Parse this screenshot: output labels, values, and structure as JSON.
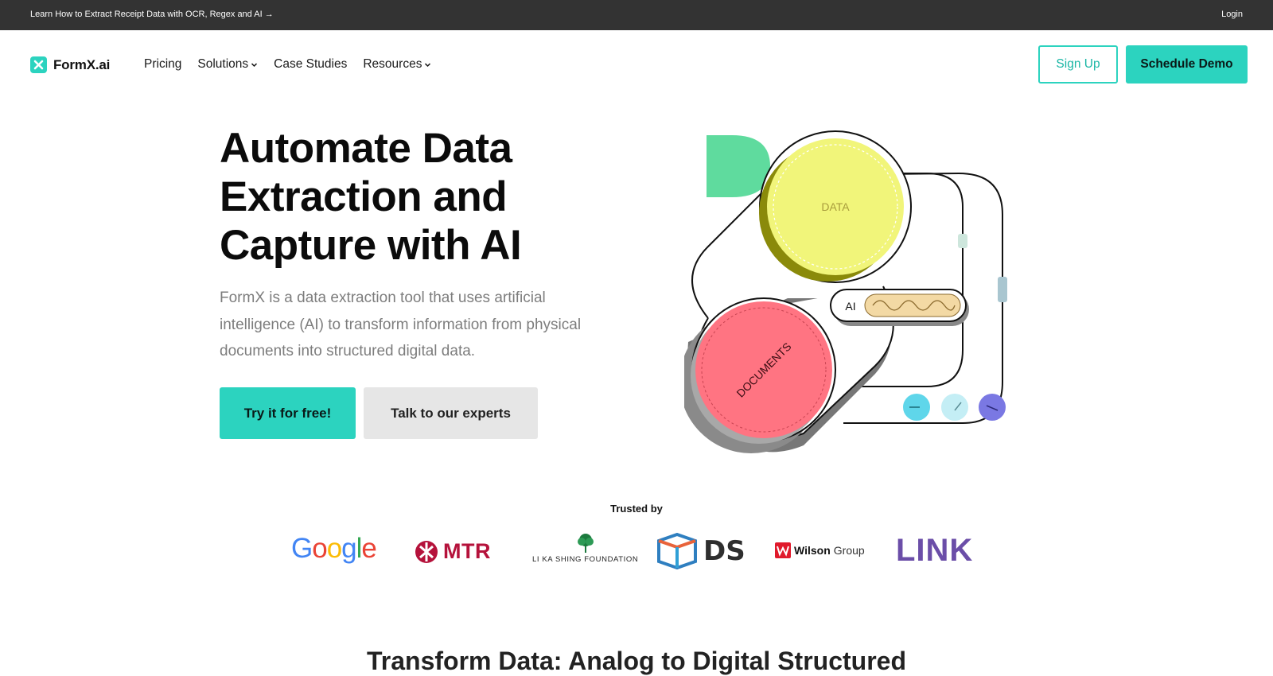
{
  "topbar": {
    "announcement": "Learn How to Extract Receipt Data with OCR, Regex and AI →",
    "login": "Login"
  },
  "nav": {
    "logo_text": "FormX.ai",
    "items": [
      {
        "label": "Pricing",
        "dropdown": false
      },
      {
        "label": "Solutions",
        "dropdown": true
      },
      {
        "label": "Case Studies",
        "dropdown": false
      },
      {
        "label": "Resources",
        "dropdown": true
      }
    ],
    "signup": "Sign Up",
    "schedule_demo": "Schedule Demo"
  },
  "hero": {
    "title_lines": [
      "Automate Data",
      "Extraction and",
      "Capture with AI"
    ],
    "subtitle": "FormX is a data extraction tool that uses artificial intelligence (AI) to transform information from physical documents into structured digital data.",
    "primary_cta": "Try it for free!",
    "secondary_cta": "Talk to our experts",
    "illustration": {
      "data_label": "DATA",
      "documents_label": "DOCUMENTS",
      "ai_label": "AI"
    }
  },
  "trusted": {
    "label": "Trusted by",
    "logos": {
      "google": "Google",
      "mtr": "MTR",
      "lks": "LI KA SHING FOUNDATION",
      "ds": "DS",
      "wilson_bold": "Wilson",
      "wilson_light": "Group",
      "link": "LINK"
    }
  },
  "section": {
    "title": "Transform Data: Analog to Digital Structured"
  },
  "colors": {
    "accent": "#2cd3bf",
    "topbar": "#333333",
    "data_circle": "#f1f57a",
    "documents_circle": "#ff7482",
    "green_shape": "#5fdb9e"
  }
}
